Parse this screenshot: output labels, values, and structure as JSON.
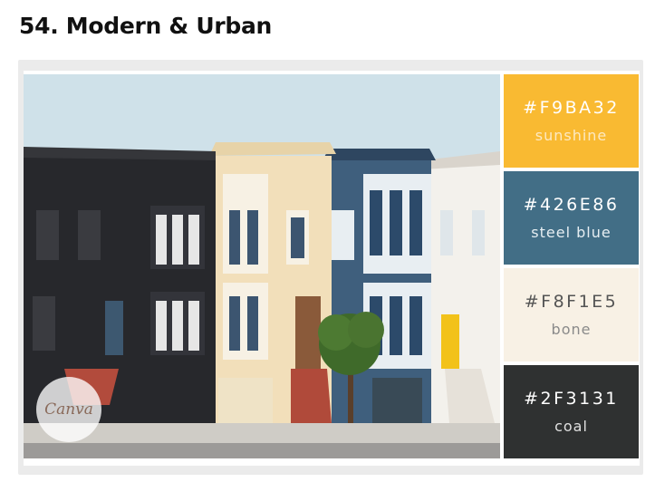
{
  "heading": "54. Modern & Urban",
  "watermark": "Canva",
  "palette": [
    {
      "hex": "#F9BA32",
      "name": "sunshine",
      "bg": "#F9BA32",
      "text": "#ffffff",
      "subtext": "#fde9c2"
    },
    {
      "hex": "#426E86",
      "name": "steel blue",
      "bg": "#426E86",
      "text": "#ffffff",
      "subtext": "#e6eef2"
    },
    {
      "hex": "#F8F1E5",
      "name": "bone",
      "bg": "#F8F1E5",
      "text": "#555555",
      "subtext": "#8a8a8a"
    },
    {
      "hex": "#2F3131",
      "name": "coal",
      "bg": "#2F3131",
      "text": "#ffffff",
      "subtext": "#e0e0e0"
    }
  ],
  "image": {
    "subject": "row of victorian houses"
  }
}
